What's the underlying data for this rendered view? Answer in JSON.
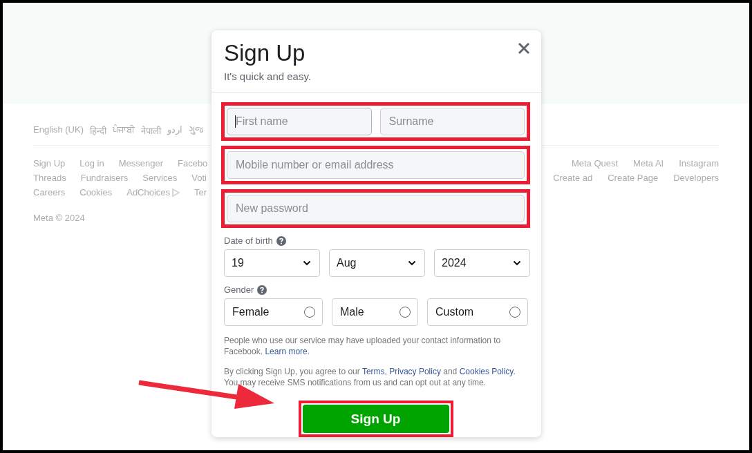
{
  "footer": {
    "languages": [
      "English (UK)",
      "हिन्दी",
      "ਪੰਜਾਬੀ",
      "नेपाली",
      "اردو",
      "ગુજ"
    ],
    "link_rows": [
      {
        "left": [
          {
            "label": "Sign Up",
            "kind": "link"
          },
          {
            "label": "Log in",
            "kind": "link"
          },
          {
            "label": "Messenger",
            "kind": "link"
          },
          {
            "label": "Facebo",
            "kind": "link"
          }
        ],
        "right": [
          {
            "label": "Meta Quest",
            "kind": "link"
          },
          {
            "label": "Meta AI",
            "kind": "link"
          },
          {
            "label": "Instagram",
            "kind": "link"
          }
        ]
      },
      {
        "left": [
          {
            "label": "Threads",
            "kind": "link"
          },
          {
            "label": "Fundraisers",
            "kind": "link"
          },
          {
            "label": "Services",
            "kind": "link"
          },
          {
            "label": "Voti",
            "kind": "link"
          }
        ],
        "right": [
          {
            "label": "Create ad",
            "kind": "link"
          },
          {
            "label": "Create Page",
            "kind": "link"
          },
          {
            "label": "Developers",
            "kind": "link"
          }
        ]
      },
      {
        "left": [
          {
            "label": "Careers",
            "kind": "link"
          },
          {
            "label": "Cookies",
            "kind": "link"
          },
          {
            "label": "AdChoices",
            "kind": "link_icon"
          },
          {
            "label": "Ter",
            "kind": "link"
          }
        ],
        "right": []
      }
    ],
    "copyright": "Meta © 2024"
  },
  "modal": {
    "title": "Sign Up",
    "subtitle": "It's quick and easy.",
    "field_groups": [
      {
        "highlighted": true,
        "fields": [
          {
            "placeholder": "First name",
            "focused": true
          },
          {
            "placeholder": "Surname",
            "focused": false
          }
        ]
      },
      {
        "highlighted": true,
        "fields": [
          {
            "placeholder": "Mobile number or email address",
            "focused": false
          }
        ]
      },
      {
        "highlighted": true,
        "fields": [
          {
            "placeholder": "New password",
            "focused": false
          }
        ]
      }
    ],
    "date_of_birth": {
      "label": "Date of birth",
      "values": [
        "19",
        "Aug",
        "2024"
      ]
    },
    "gender": {
      "label": "Gender",
      "options": [
        {
          "label": "Female",
          "selected": false
        },
        {
          "label": "Male",
          "selected": false
        },
        {
          "label": "Custom",
          "selected": false
        }
      ]
    },
    "notices": [
      [
        {
          "text": "People who use our service may have uploaded your contact information to Facebook. ",
          "kind": "text"
        },
        {
          "text": "Learn more",
          "kind": "link"
        },
        {
          "text": ".",
          "kind": "text"
        }
      ],
      [
        {
          "text": "By clicking Sign Up, you agree to our ",
          "kind": "text"
        },
        {
          "text": "Terms",
          "kind": "link"
        },
        {
          "text": ", ",
          "kind": "text"
        },
        {
          "text": "Privacy Policy",
          "kind": "link"
        },
        {
          "text": " and ",
          "kind": "text"
        },
        {
          "text": "Cookies Policy",
          "kind": "link"
        },
        {
          "text": ". You may receive SMS notifications from us and can opt out at any time.",
          "kind": "text"
        }
      ]
    ],
    "submit": {
      "label": "Sign Up",
      "highlighted": true
    }
  },
  "annotation_arrow": true
}
